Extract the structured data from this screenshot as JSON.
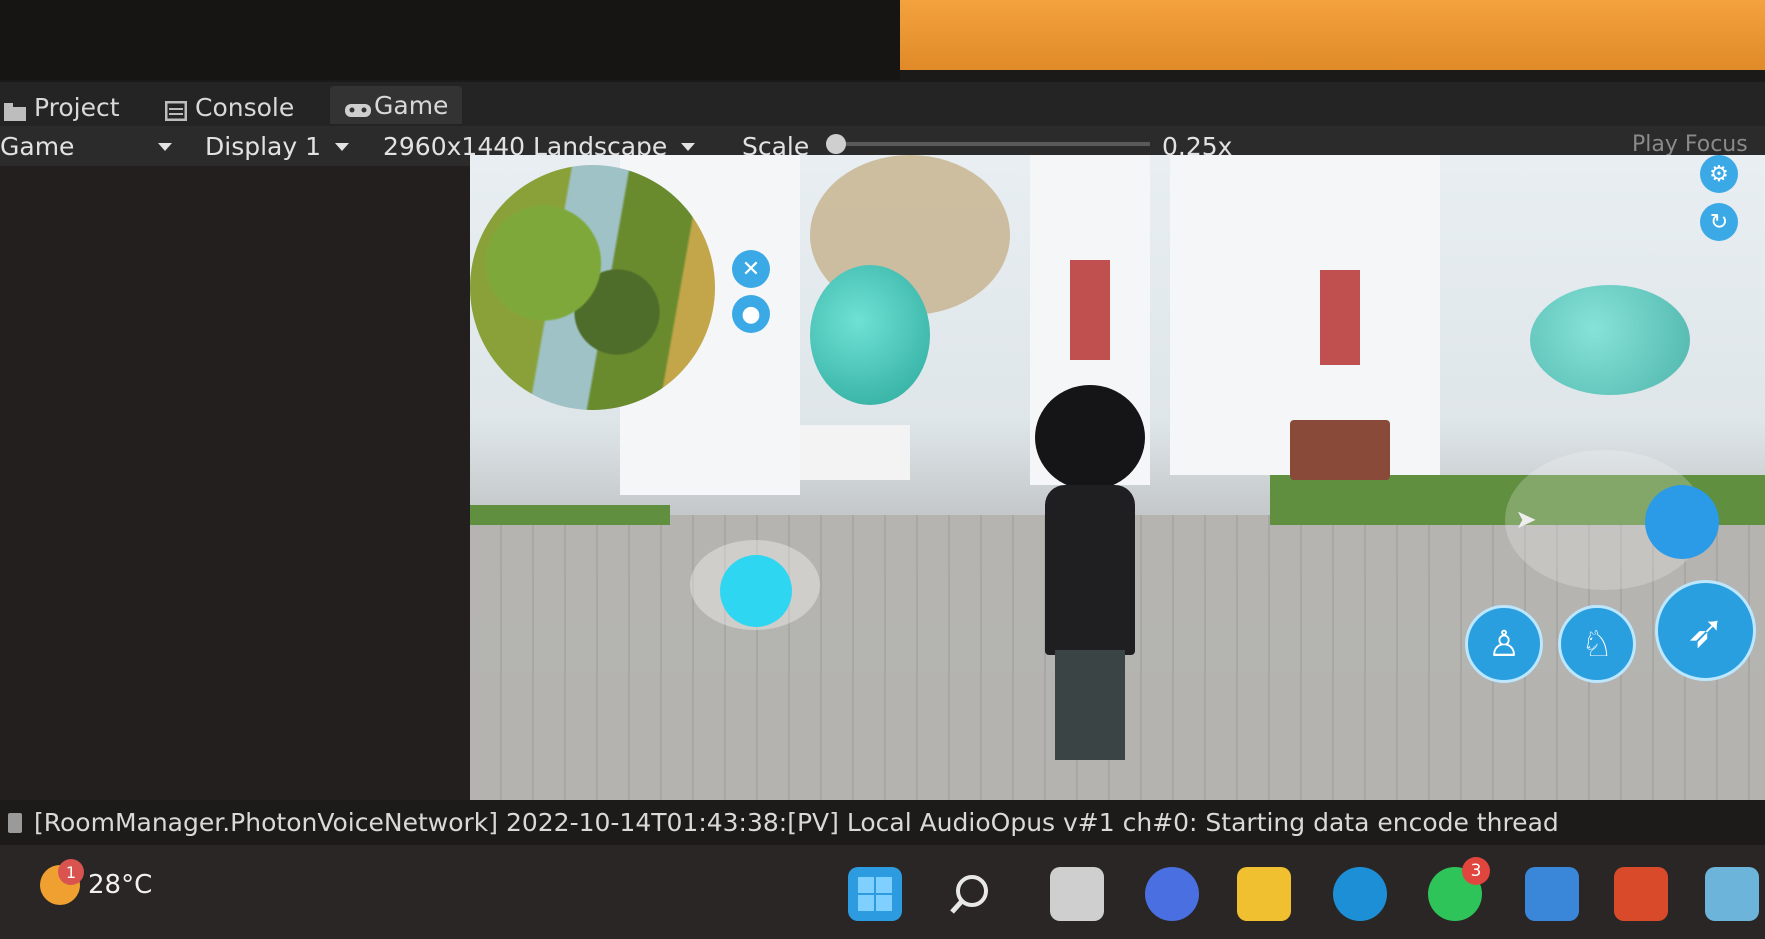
{
  "tabs": [
    {
      "label": "Project"
    },
    {
      "label": "Console"
    },
    {
      "label": "Game"
    }
  ],
  "toolbar": {
    "view_select": "Game",
    "display_select": "Display 1",
    "resolution_select": "2960x1440 Landscape",
    "scale_label": "Scale",
    "scale_value": "0.25x",
    "play_focus": "Play Focus"
  },
  "console": {
    "message": "[RoomManager.PhotonVoiceNetwork] 2022-10-14T01:43:38:[PV] Local AudioOpus v#1 ch#0: Starting data encode thread"
  },
  "taskbar": {
    "weather_temp": "28°C",
    "weather_badge": "1",
    "apps": [
      {
        "name": "windows-start-icon"
      },
      {
        "name": "search-icon"
      },
      {
        "name": "file-manager-icon"
      },
      {
        "name": "video-call-icon"
      },
      {
        "name": "folder-icon"
      },
      {
        "name": "edge-icon"
      },
      {
        "name": "whatsapp-icon",
        "badge": "3"
      },
      {
        "name": "photos-icon"
      },
      {
        "name": "office-icon"
      },
      {
        "name": "image-viewer-icon"
      }
    ]
  },
  "colors": {
    "accent": "#2fd6f2",
    "button": "#2a9fe0",
    "pillar": "#c0504f",
    "background": "#1c1a19"
  }
}
